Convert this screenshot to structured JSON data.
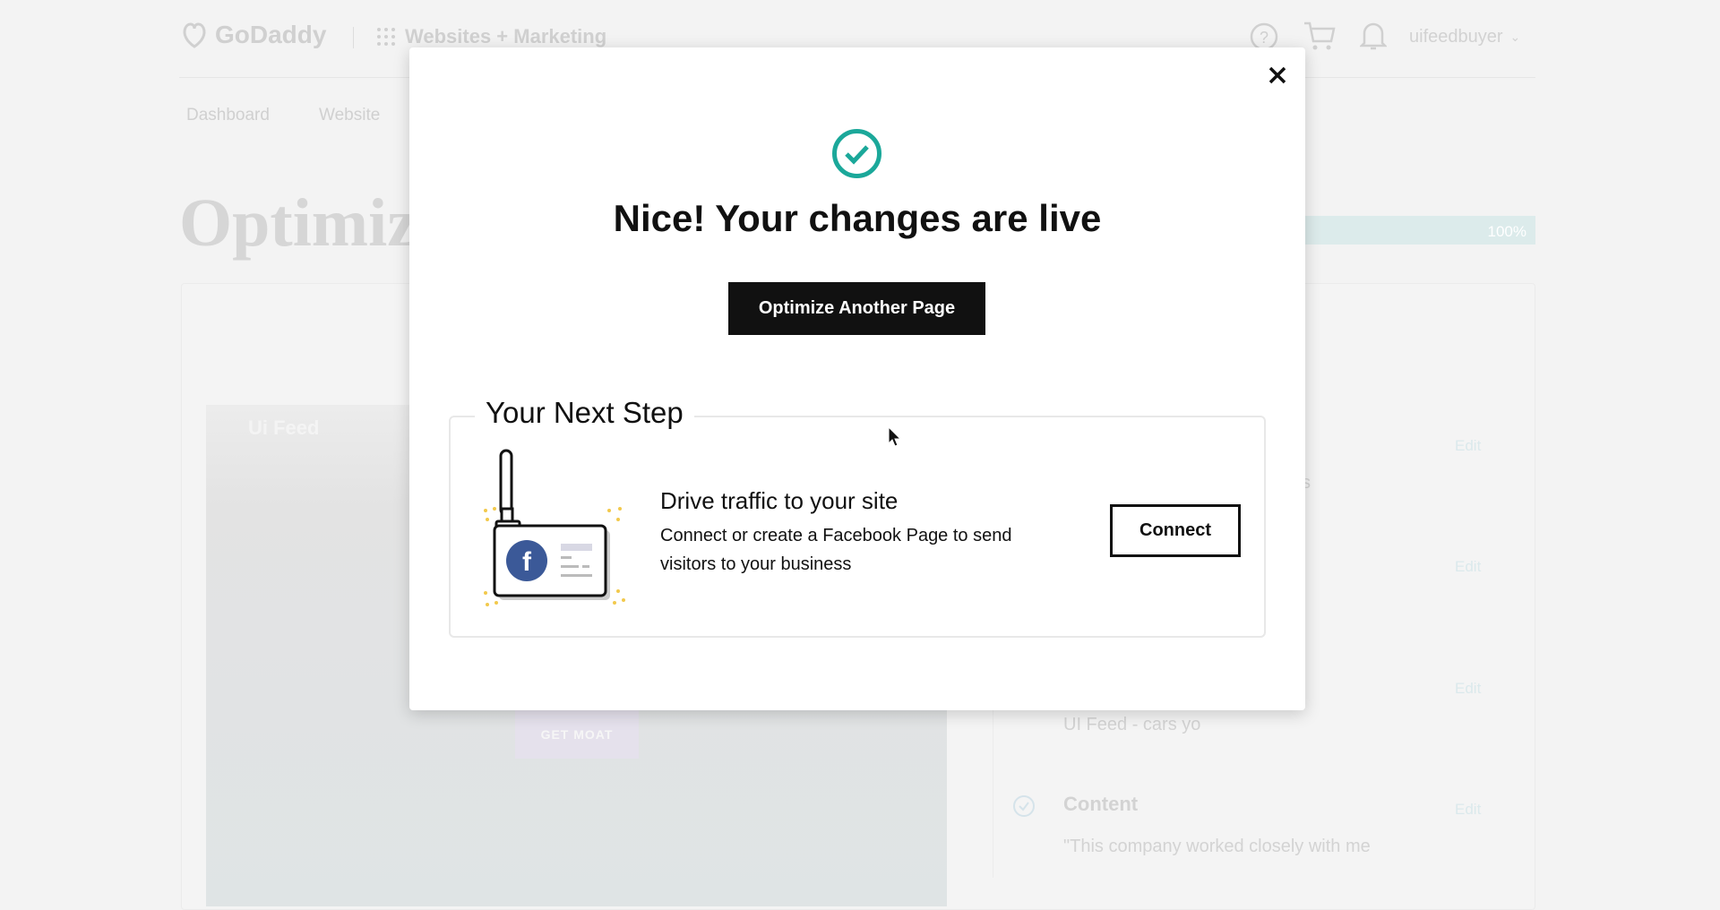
{
  "header": {
    "brand": "GoDaddy",
    "product": "Websites + Marketing",
    "username": "uifeedbuyer"
  },
  "nav": {
    "items": [
      "Dashboard",
      "Website"
    ]
  },
  "page": {
    "title": "Optimize",
    "progress_percent": 100,
    "progress_label": "100%"
  },
  "preview": {
    "site_name": "Ui Feed",
    "cta": "GET MOAT"
  },
  "checklist": {
    "edit_label": "Edit",
    "partial_text": "s",
    "site_title_value": "UI Feed - cars yo",
    "content_heading": "Content",
    "content_value": "\"This company worked closely with me"
  },
  "modal": {
    "title": "Nice! Your changes are live",
    "primary_button": "Optimize Another Page",
    "next_step_legend": "Your Next Step",
    "next_step_heading": "Drive traffic to your site",
    "next_step_description": "Connect or create a Facebook Page to send visitors to your business",
    "connect_button": "Connect"
  },
  "colors": {
    "success": "#1ba89a",
    "facebook": "#3b5998",
    "button_dark": "#111111"
  }
}
